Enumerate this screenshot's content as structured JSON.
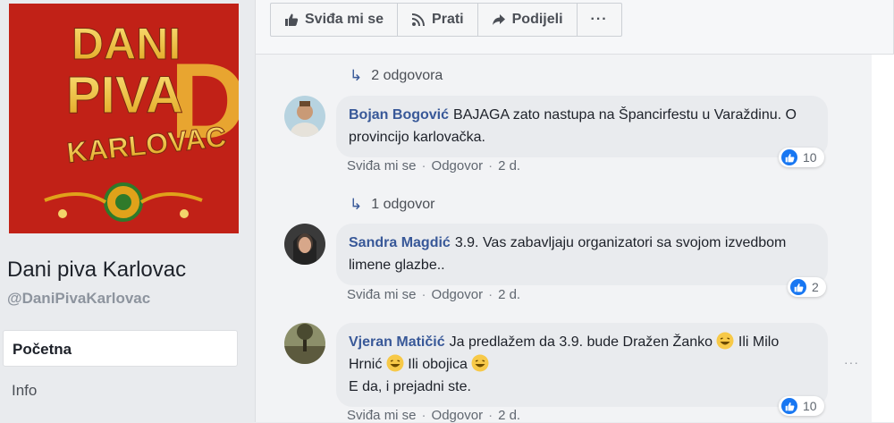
{
  "page": {
    "cover_text": {
      "line1": "DANI",
      "line2": "PIVA",
      "line3": "KARLOVAC",
      "letter": "D"
    },
    "name": "Dani piva Karlovac",
    "handle": "@DaniPivaKarlovac",
    "nav": {
      "home": "Početna",
      "info": "Info"
    }
  },
  "actions": {
    "like": "Sviđa mi se",
    "follow": "Prati",
    "share": "Podijeli",
    "more": "···"
  },
  "comments": {
    "replies_1": "2 odgovora",
    "replies_2": "1 odgovor",
    "items": [
      {
        "author": "Bojan Bogović",
        "text": "BAJAGA zato nastupa na Špancirfestu u Varaždinu. O provincijo karlovačka.",
        "like": "Sviđa mi se",
        "reply": "Odgovor",
        "time": "2 d.",
        "reactions": "10"
      },
      {
        "author": "Sandra Magdić",
        "text": "3.9. Vas zabavljaju organizatori sa svojom izvedbom limene glazbe..",
        "like": "Sviđa mi se",
        "reply": "Odgovor",
        "time": "2 d.",
        "reactions": "2"
      },
      {
        "author": "Vjeran Matičić",
        "text_a": "Ja predlažem da 3.9. bude Dražen Žanko",
        "text_b": "Ili Milo Hrnić",
        "text_c": "Ili obojica",
        "text_d": "E da, i prejadni ste.",
        "like": "Sviđa mi se",
        "reply": "Odgovor",
        "time": "2 d.",
        "reactions": "10"
      }
    ],
    "more_options": "···"
  },
  "colors": {
    "link": "#385898",
    "like_blue": "#1877f2",
    "cover_red": "#c8241a",
    "bubble": "#e9ebee"
  },
  "icons": [
    "thumbs-up-icon",
    "rss-icon",
    "share-arrow-icon",
    "more-icon",
    "reply-arrow-icon",
    "laughing-emoji-icon",
    "like-reaction-icon"
  ]
}
